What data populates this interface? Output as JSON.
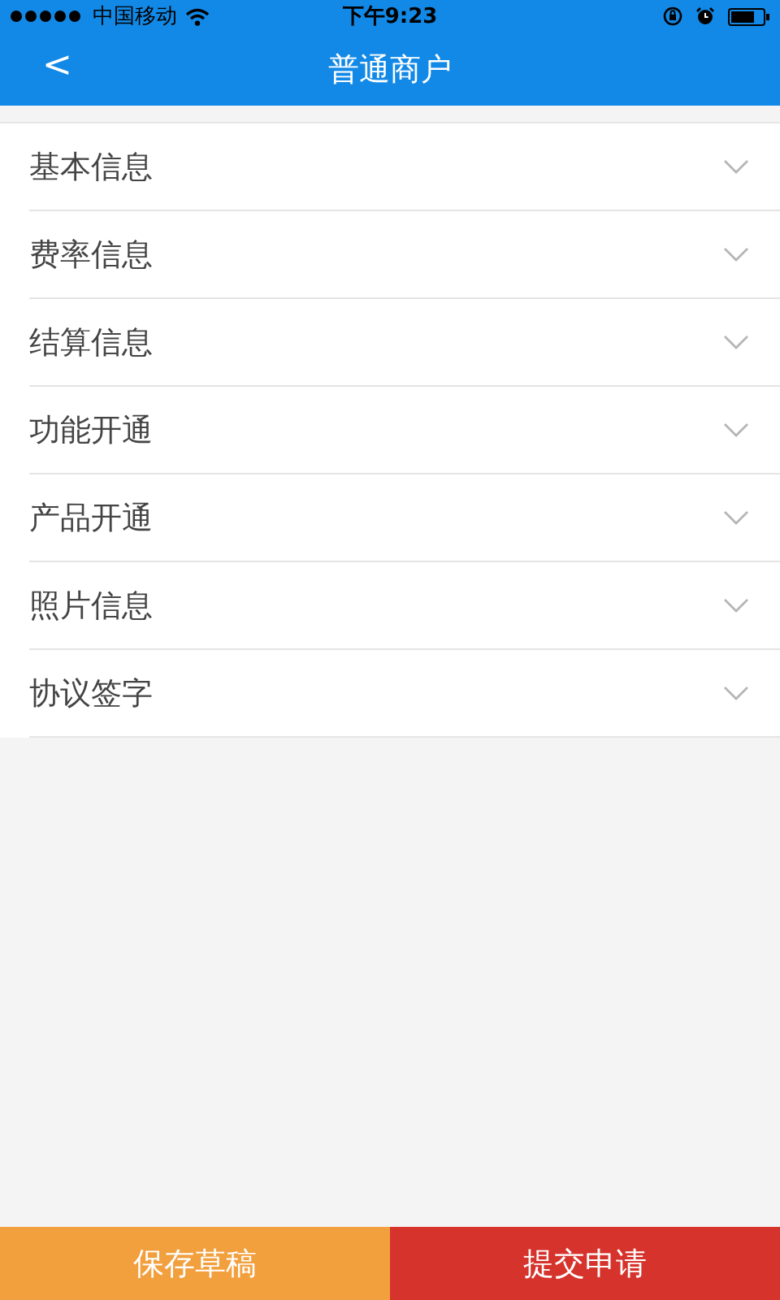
{
  "status_bar": {
    "carrier": "中国移动",
    "time": "下午9:23"
  },
  "nav_bar": {
    "back": "<",
    "title": "普通商户"
  },
  "sections": [
    {
      "label": "基本信息",
      "expanded": false
    },
    {
      "label": "费率信息",
      "expanded": false
    },
    {
      "label": "结算信息",
      "expanded": false
    },
    {
      "label": "功能开通",
      "expanded": false
    },
    {
      "label": "产品开通",
      "expanded": false
    },
    {
      "label": "照片信息",
      "expanded": false
    },
    {
      "label": "协议签字",
      "expanded": false
    }
  ],
  "buttons": [
    {
      "label": "保存草稿",
      "kind": "draft"
    },
    {
      "label": "提交申请",
      "kind": "submit"
    }
  ]
}
